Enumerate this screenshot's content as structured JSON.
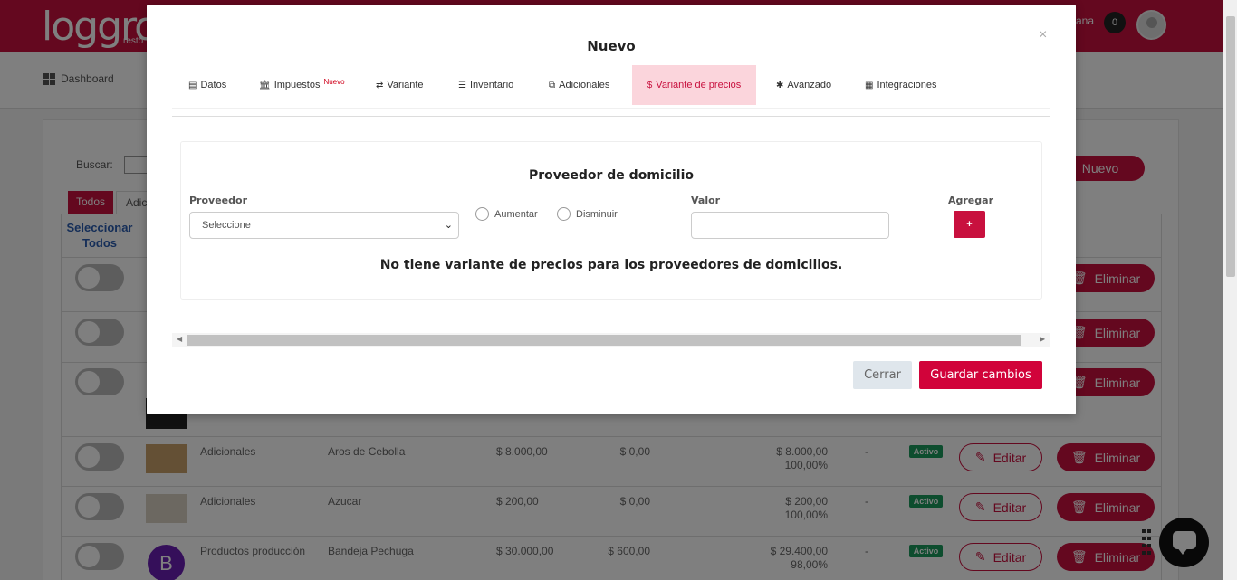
{
  "app": {
    "logo_text": "loggro",
    "logo_sub": "resto",
    "top_right_text": "ana",
    "notification_count": "0",
    "nav": {
      "dashboard_label": "Dashboard"
    },
    "search_label": "Buscar:",
    "new_button": "Nuevo",
    "filter_tabs": [
      "Todos",
      "Adic"
    ],
    "select_all_label": "Seleccionar Todos",
    "actions": {
      "edit": "Editar",
      "delete": "Eliminar"
    },
    "rows": [
      {
        "category": "Adicionales",
        "name": "Aros de Cebolla",
        "price": "$ 8.000,00",
        "tax": "$ 0,00",
        "total": "$ 8.000,00",
        "percent": "100,00%",
        "dash": "-",
        "status": "Activo"
      },
      {
        "category": "Adicionales",
        "name": "Azucar",
        "price": "$ 200,00",
        "tax": "$ 0,00",
        "total": "$ 200,00",
        "percent": "100,00%",
        "dash": "-",
        "status": "Activo"
      },
      {
        "category": "Productos producción",
        "name": "Bandeja Pechuga",
        "price": "$ 30.000,00",
        "tax": "$ 600,00",
        "total": "$ 29.400,00",
        "percent": "98,00%",
        "dash": "-",
        "status": "Activo",
        "avatar_letter": "B"
      }
    ]
  },
  "modal": {
    "title": "Nuevo",
    "close": "×",
    "tabs": [
      {
        "label": "Datos",
        "icon": "▤"
      },
      {
        "label": "Impuestos",
        "icon": "🏛",
        "sup": "Nuevo"
      },
      {
        "label": "Variante",
        "icon": "⇄"
      },
      {
        "label": "Inventario",
        "icon": "☰"
      },
      {
        "label": "Adicionales",
        "icon": "⧉"
      },
      {
        "label": "Variante de precios",
        "icon": "$"
      },
      {
        "label": "Avanzado",
        "icon": "✱"
      },
      {
        "label": "Integraciones",
        "icon": "▦"
      }
    ],
    "section_title": "Proveedor de domicilio",
    "provider_label": "Proveedor",
    "provider_placeholder": "Seleccione",
    "radio_increase": "Aumentar",
    "radio_decrease": "Disminuir",
    "value_label": "Valor",
    "add_label": "Agregar",
    "add_button": "+",
    "empty_message": "No tiene variante de precios para los proveedores de domicilios.",
    "cancel_button": "Cerrar",
    "save_button": "Guardar cambios"
  }
}
